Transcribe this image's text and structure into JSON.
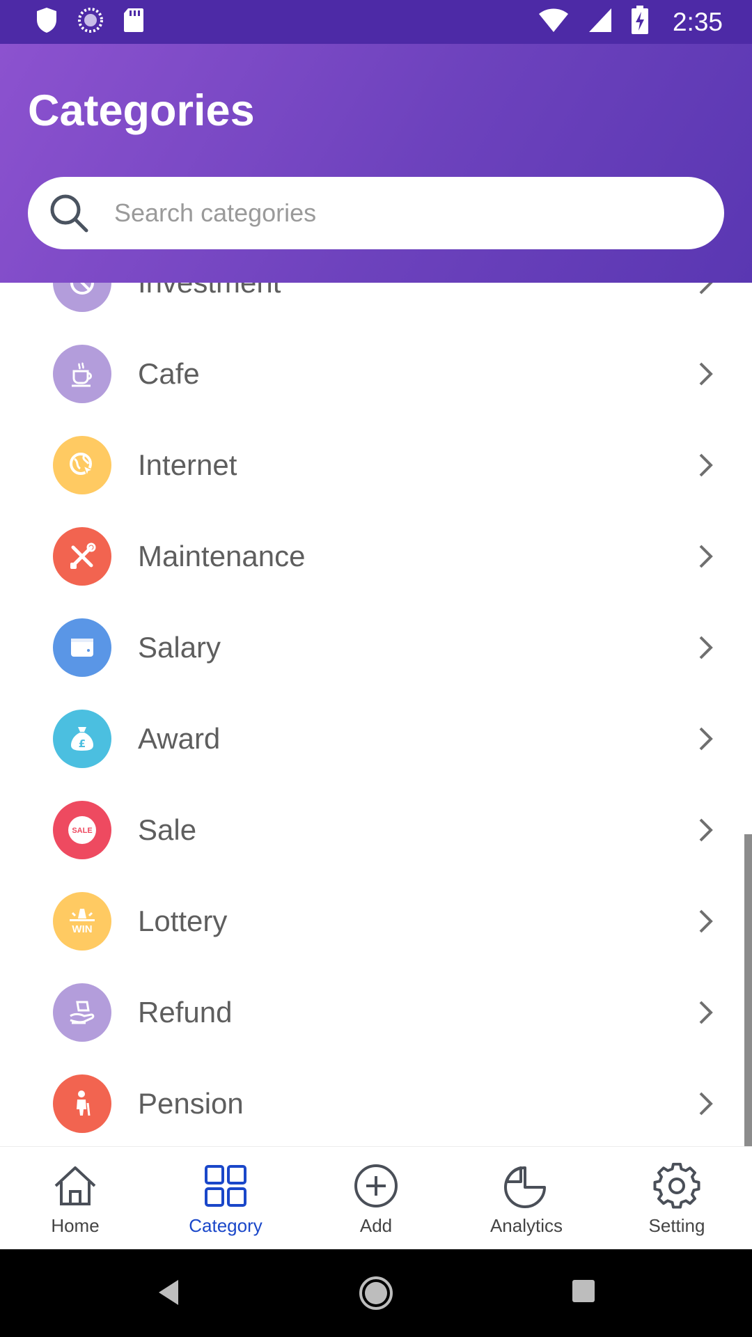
{
  "status_bar": {
    "time": "2:35"
  },
  "header": {
    "title": "Categories",
    "search": {
      "placeholder": "Search categories",
      "value": ""
    }
  },
  "categories": [
    {
      "label": "Investment",
      "icon": "investment-icon",
      "color": "#b39ddb"
    },
    {
      "label": "Cafe",
      "icon": "coffee-cup-icon",
      "color": "#b39ddb"
    },
    {
      "label": "Internet",
      "icon": "globe-cursor-icon",
      "color": "#ffca62"
    },
    {
      "label": "Maintenance",
      "icon": "tools-icon",
      "color": "#f26450"
    },
    {
      "label": "Salary",
      "icon": "wallet-icon",
      "color": "#5a96e6"
    },
    {
      "label": "Award",
      "icon": "money-bag-icon",
      "color": "#4bbfe0"
    },
    {
      "label": "Sale",
      "icon": "sale-badge-icon",
      "color": "#ee4a60"
    },
    {
      "label": "Lottery",
      "icon": "win-icon",
      "color": "#ffca62"
    },
    {
      "label": "Refund",
      "icon": "hand-money-icon",
      "color": "#b39ddb"
    },
    {
      "label": "Pension",
      "icon": "elderly-person-icon",
      "color": "#f26450"
    }
  ],
  "sale_badge_text": "SALE",
  "lottery_badge_text": "WIN",
  "bottom_nav": {
    "items": [
      {
        "label": "Home",
        "icon": "home-icon"
      },
      {
        "label": "Category",
        "icon": "grid-icon",
        "active": true
      },
      {
        "label": "Add",
        "icon": "plus-circle-icon"
      },
      {
        "label": "Analytics",
        "icon": "pie-chart-icon"
      },
      {
        "label": "Setting",
        "icon": "gear-icon"
      }
    ]
  },
  "colors": {
    "header_gradient_start": "#8c52cf",
    "header_gradient_end": "#5a37b2",
    "status_bar": "#4d2aa6",
    "active_nav": "#1a47c9"
  }
}
